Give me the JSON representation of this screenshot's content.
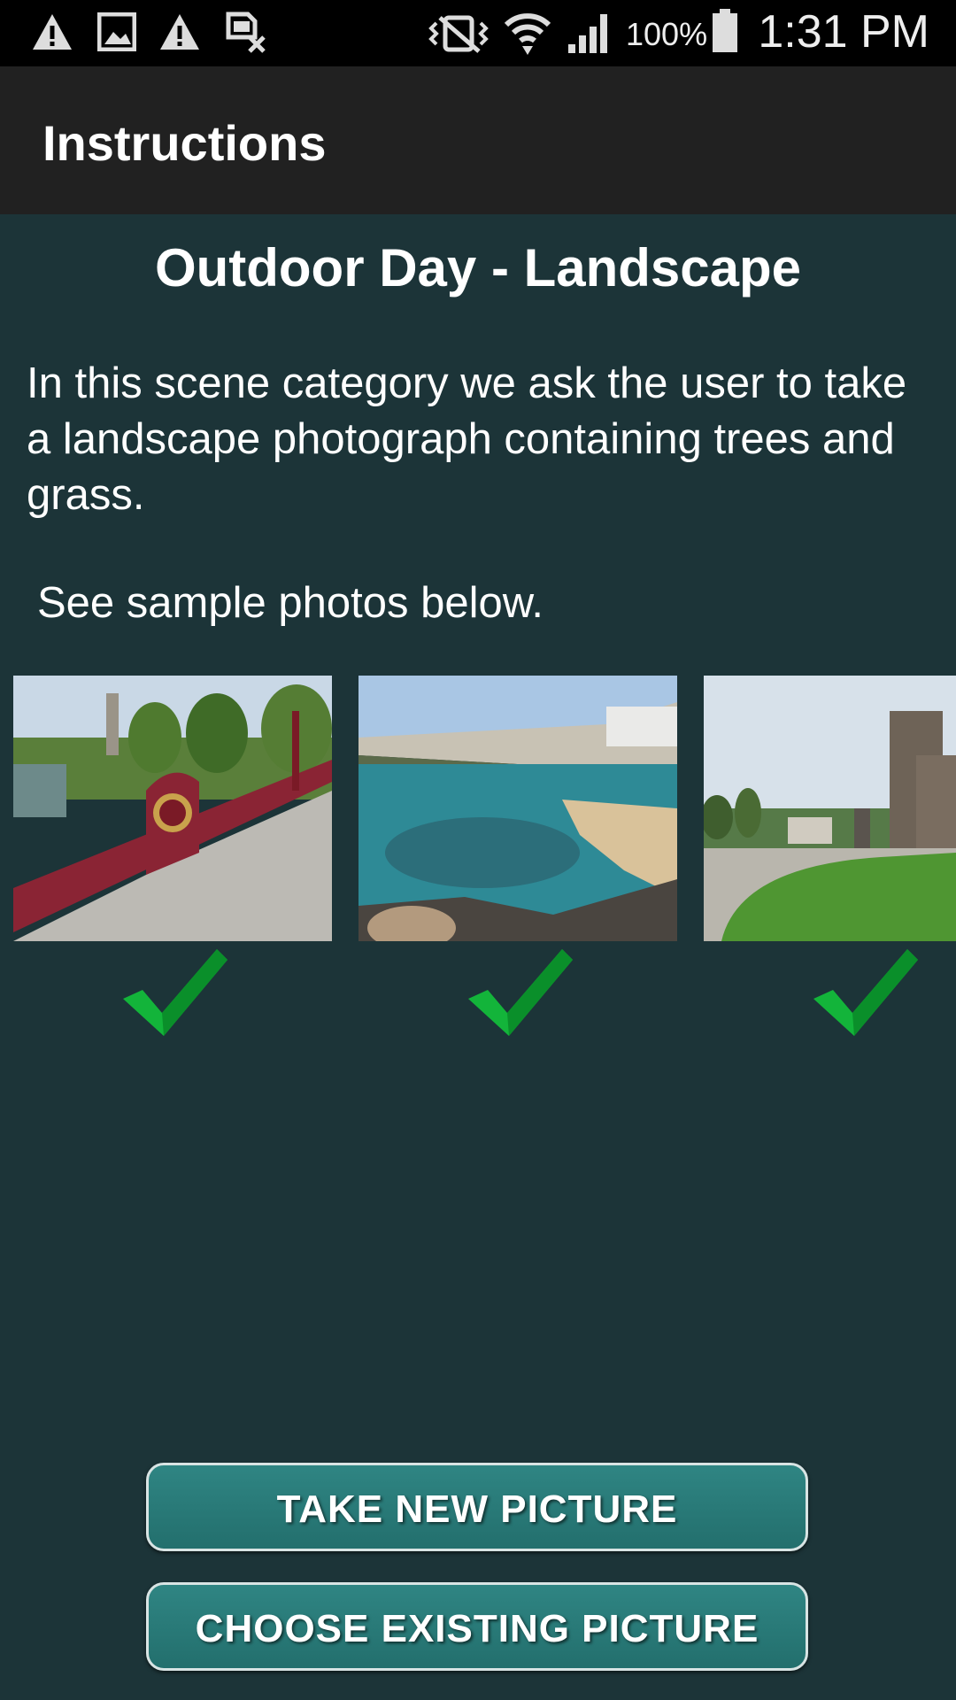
{
  "status_bar": {
    "battery": "100%",
    "time": "1:31 PM",
    "icons": [
      "warning-icon",
      "image-icon",
      "warning-icon",
      "sim-off-icon",
      "vibrate-icon",
      "wifi-icon",
      "signal-icon",
      "battery-icon"
    ]
  },
  "app_bar": {
    "title": "Instructions"
  },
  "content": {
    "heading": "Outdoor Day - Landscape",
    "description": "In this scene category we ask the user to take a landscape photograph containing trees and grass.",
    "sample_note": "See sample photos below."
  },
  "buttons": {
    "take_new": "TAKE NEW PICTURE",
    "choose_existing": "CHOOSE EXISTING PICTURE"
  },
  "colors": {
    "background": "#1c3438",
    "app_bar": "#212121",
    "button": "#2a7b79",
    "check": "#13b43a"
  }
}
